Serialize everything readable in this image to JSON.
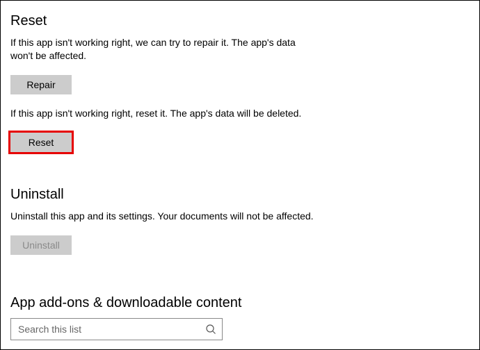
{
  "reset": {
    "heading": "Reset",
    "repair_desc": "If this app isn't working right, we can try to repair it. The app's data won't be affected.",
    "repair_label": "Repair",
    "reset_desc": "If this app isn't working right, reset it. The app's data will be deleted.",
    "reset_label": "Reset"
  },
  "uninstall": {
    "heading": "Uninstall",
    "desc": "Uninstall this app and its settings. Your documents will not be affected.",
    "button_label": "Uninstall"
  },
  "addons": {
    "heading": "App add-ons & downloadable content",
    "search_placeholder": "Search this list"
  }
}
